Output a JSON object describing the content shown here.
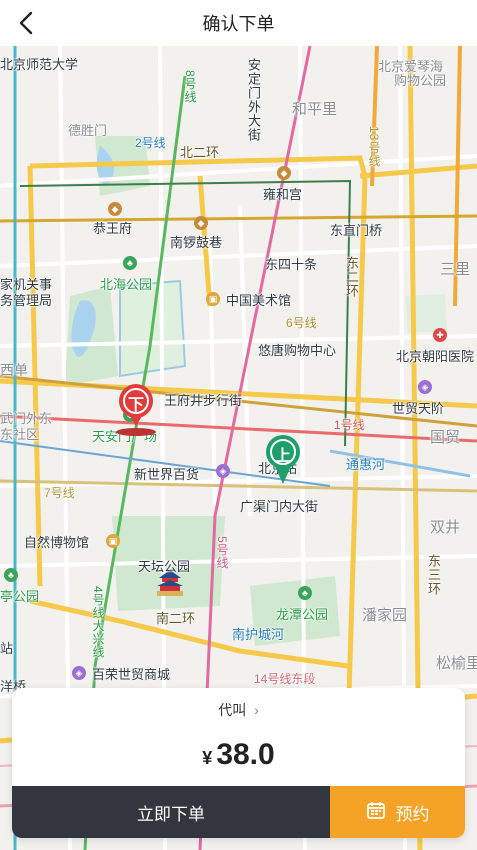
{
  "header": {
    "title": "确认下单"
  },
  "map": {
    "labels": {
      "bnu": "北京师范大学",
      "deshengmen": "德胜门",
      "line2": "2号线",
      "line8": "8号线",
      "beierhuan": "北二环",
      "andingmen": "安定门外大街",
      "hepingli": "和平里",
      "beijing_aiqinhai": "北京爱琴海",
      "aiqinhai_mall": "购物公园",
      "line13": "13号线",
      "yonghegong": "雍和宫",
      "gongwangfu": "恭王府",
      "nanluoguxiang": "南锣鼓巷",
      "dongzhimenqiao": "东直门桥",
      "dongsishitiao": "东四十条",
      "dongerhuan": "东二环",
      "sanlitun": "三里",
      "beihai": "北海公园",
      "jiguan": "家机关事",
      "guanliju": "务管理局",
      "meishuguan": "中国美术馆",
      "line6": "6号线",
      "youtang": "悠唐购物中心",
      "chaoyang": "北京朝阳医院",
      "xidan": "西单",
      "wangfujing": "王府井步行街",
      "shimao": "世贸天阶",
      "wuyimen": "武门外东",
      "shequ": "东社区",
      "line1": "1号线",
      "guomao": "国贸",
      "tiananmen": "天安门广场",
      "bjstation": "北京站",
      "tonghuihe": "通惠河",
      "xinshijie": "新世界百货",
      "line7": "7号线",
      "guangqumen": "广渠门内大街",
      "shuangjing": "双井",
      "bowuguan": "自然博物馆",
      "tiantan": "天坛公园",
      "line5": "5号线",
      "dongsanhuan": "东三环",
      "taoranting": "亭公园",
      "line4": "4号线大兴线",
      "nanerhuan": "南二环",
      "longtan": "龙潭公园",
      "panjiayuan": "潘家园",
      "huchenghe": "南护城河",
      "zhan": "站",
      "bairong": "百荣世贸商城",
      "line14": "14号线东段",
      "songyuli": "松榆里",
      "yangqiao": "洋桥"
    },
    "pickup_badge": "上",
    "dropoff_badge": "下"
  },
  "order_card": {
    "car_type": "代叫",
    "currency": "¥",
    "price": "38.0",
    "order_button": "立即下单",
    "reserve_button": "预约"
  },
  "colors": {
    "accent": "#f5a326",
    "dark_button": "#33353f",
    "pickup_green": "#1e9e6a",
    "dropoff_red": "#e23b3b"
  }
}
